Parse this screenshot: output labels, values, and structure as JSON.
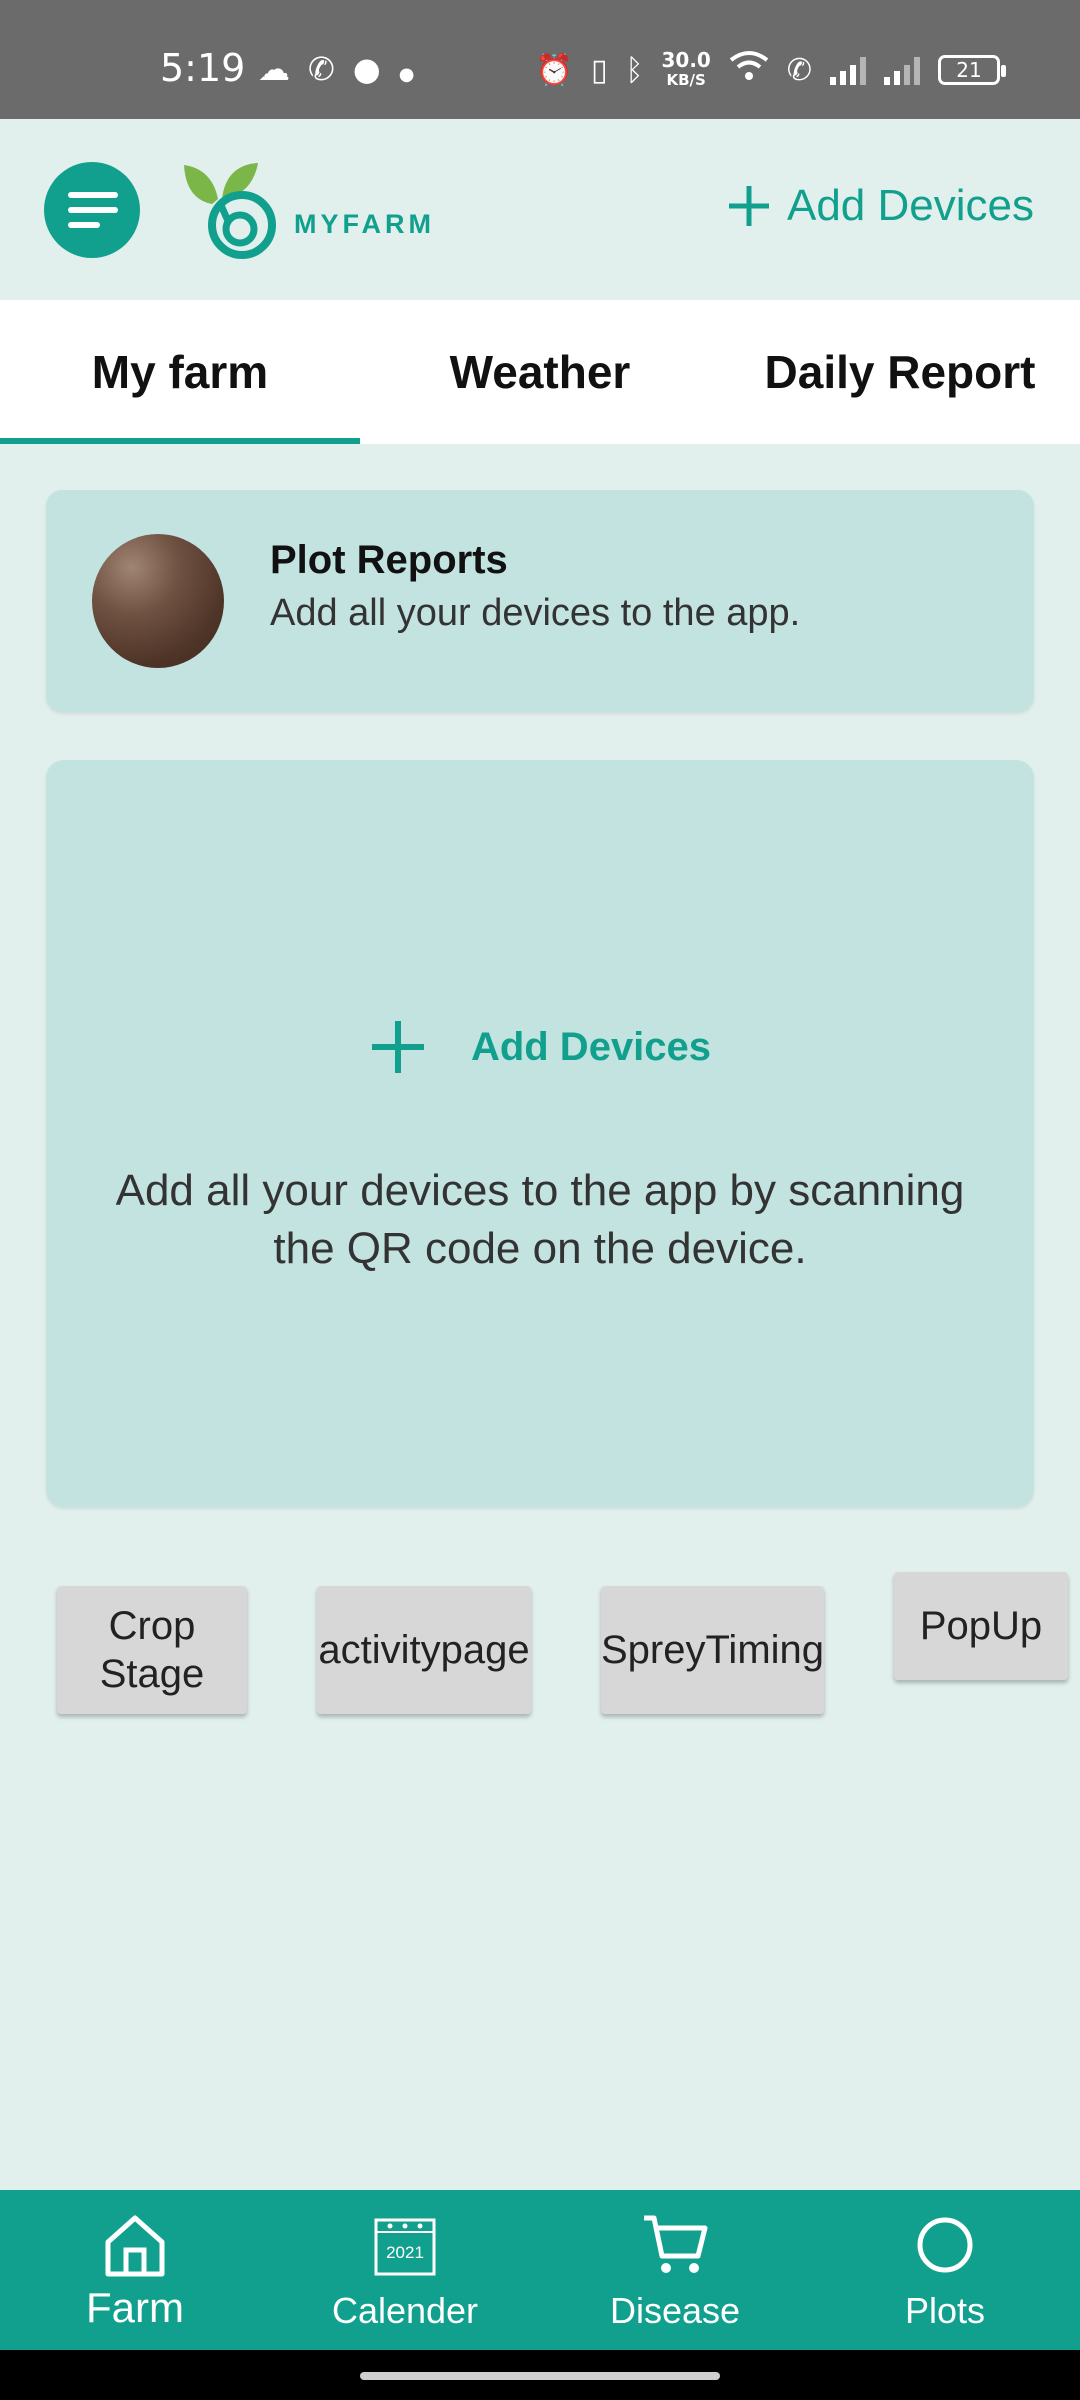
{
  "status_bar": {
    "time": "5:19",
    "network_speed_value": "30.0",
    "network_speed_unit": "KB/S",
    "battery": "21"
  },
  "header": {
    "logo_text": "MYFARM",
    "add_devices_label": "Add Devices"
  },
  "tabs": [
    {
      "label": "My farm",
      "active": true
    },
    {
      "label": "Weather",
      "active": false
    },
    {
      "label": "Daily Report",
      "active": false
    }
  ],
  "plot_card": {
    "title": "Plot Reports",
    "subtitle": "Add all your devices to the app."
  },
  "add_card": {
    "label": "Add Devices",
    "description": "Add all your devices to the app by scanning the QR code on the device."
  },
  "quick_buttons": [
    {
      "label": "Crop Stage"
    },
    {
      "label": "activitypage"
    },
    {
      "label": "SpreyTiming"
    },
    {
      "label": "PopUp"
    }
  ],
  "bottom_nav": [
    {
      "label": "Farm",
      "icon": "home-icon",
      "active": true
    },
    {
      "label": "Calender",
      "icon": "calendar-icon",
      "active": false,
      "icon_text": "2021"
    },
    {
      "label": "Disease",
      "icon": "cart-icon",
      "active": false
    },
    {
      "label": "Plots",
      "icon": "circle-icon",
      "active": false
    }
  ],
  "colors": {
    "accent": "#12a08e",
    "background": "#e1efed",
    "card": "#c3e3e0"
  }
}
